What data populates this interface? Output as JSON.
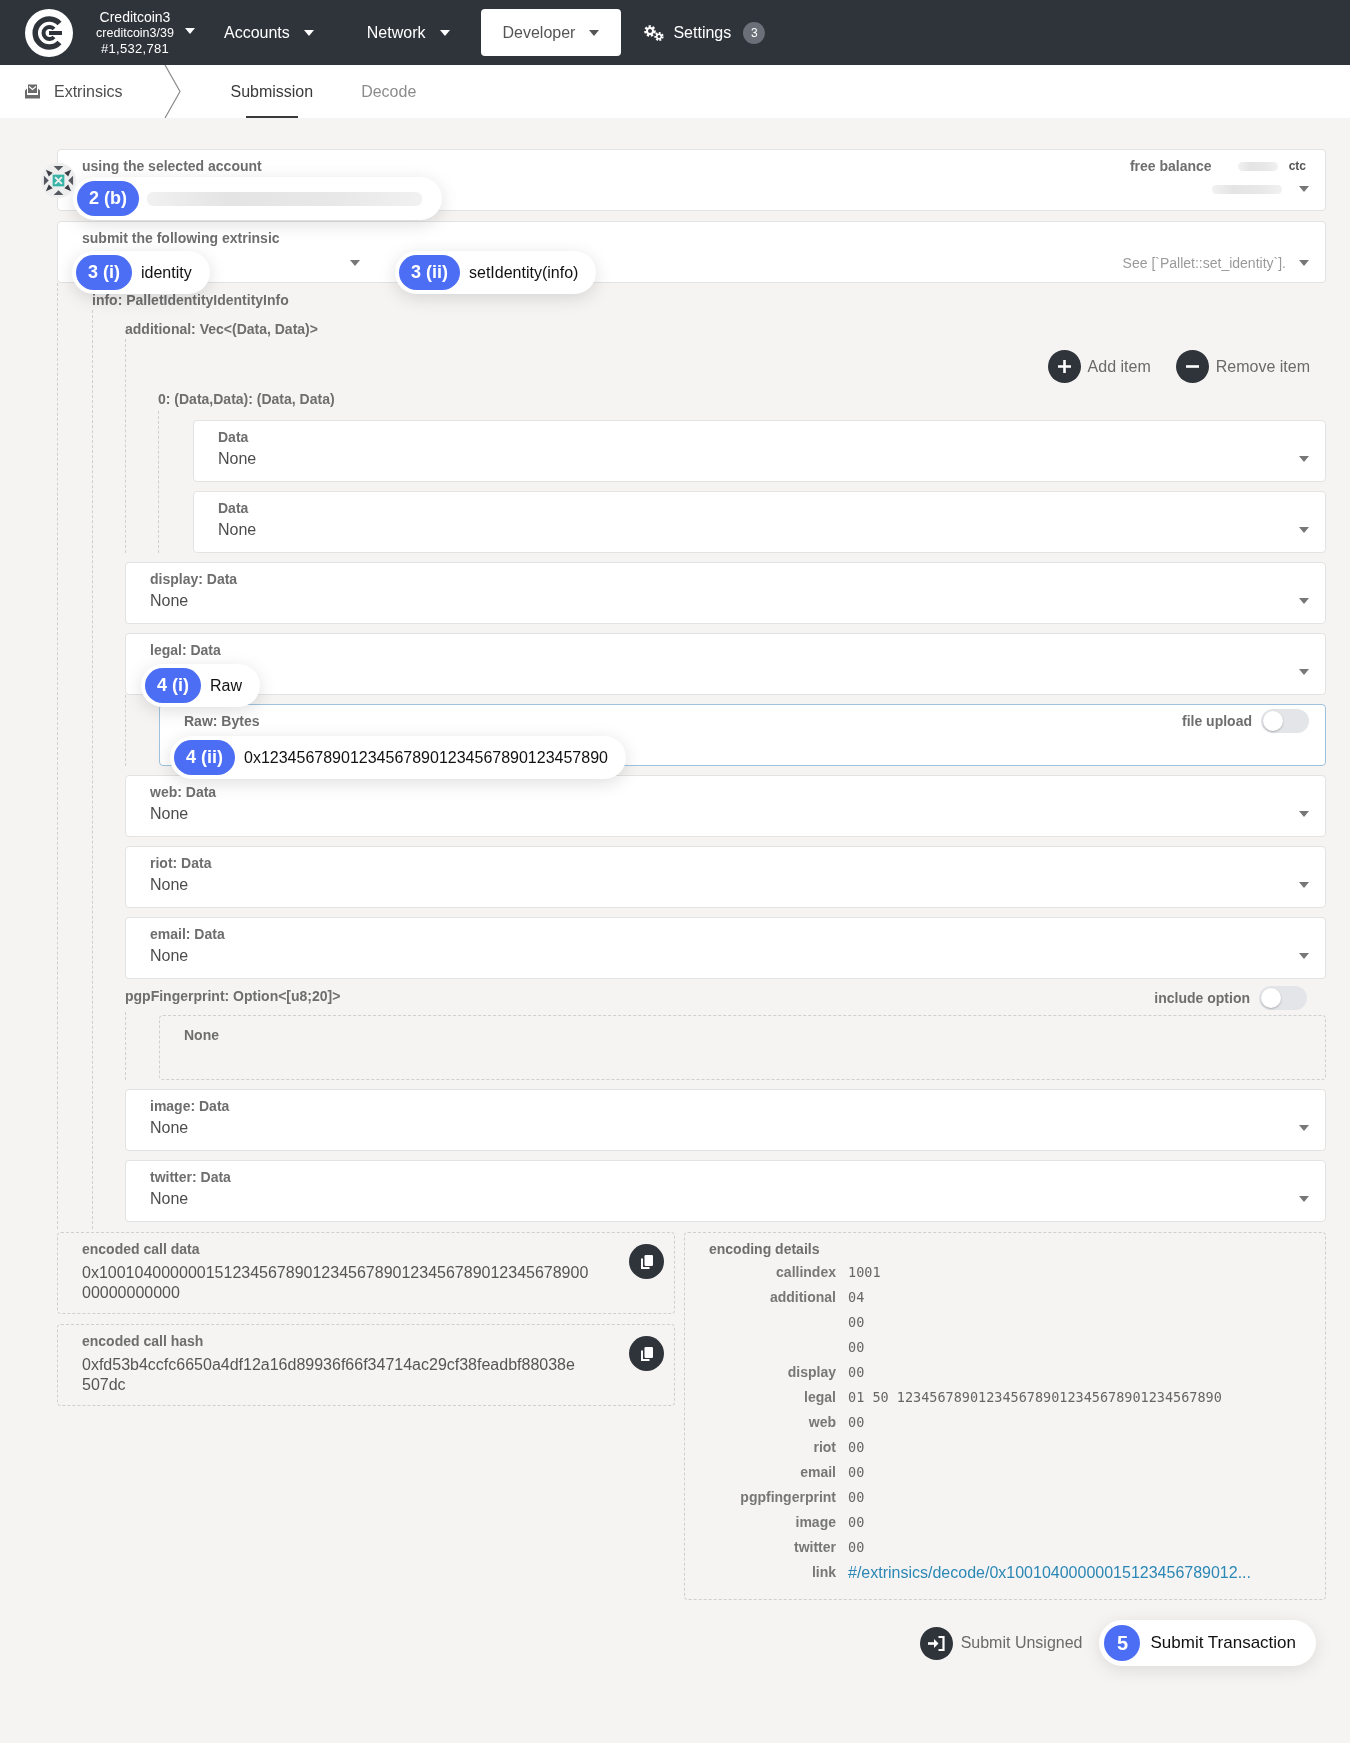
{
  "top_bar": {
    "chain": {
      "name": "Creditcoin3",
      "runtime": "creditcoin3/39",
      "block": "#1,532,781"
    },
    "menu": [
      {
        "kind": "dropdown",
        "label": "Accounts",
        "selected": false
      },
      {
        "kind": "dropdown",
        "label": "Network",
        "selected": false
      },
      {
        "kind": "dropdown",
        "label": "Developer",
        "selected": true
      },
      {
        "kind": "settings",
        "label": "Settings",
        "selected": false,
        "badge": "3"
      }
    ]
  },
  "sub_nav": {
    "section": "Extrinsics",
    "tabs": [
      {
        "label": "Submission",
        "selected": true
      },
      {
        "label": "Decode",
        "selected": false
      }
    ]
  },
  "account": {
    "label": "using the selected account",
    "step": "2 (b)",
    "balance_label": "free balance",
    "balance_unit": "ctc"
  },
  "extrinsic": {
    "label": "submit the following extrinsic",
    "section": {
      "step": "3 (i)",
      "value": "identity"
    },
    "method": {
      "step": "3 (ii)",
      "value": "setIdentity(info)"
    },
    "doc": "See [`Pallet::set_identity`]."
  },
  "params": {
    "label": "info: PalletIdentityIdentityInfo",
    "fields": [
      {
        "kind": "vec",
        "label": "additional: Vec<(Data, Data)>",
        "buttons": [
          {
            "kind": "add",
            "label": "Add item"
          },
          {
            "kind": "remove",
            "label": "Remove item"
          }
        ],
        "items": [
          {
            "label": "0: (Data,Data): (Data, Data)",
            "fields": [
              {
                "kind": "select",
                "label": "Data",
                "value": "None"
              },
              {
                "kind": "select",
                "label": "Data",
                "value": "None"
              }
            ]
          }
        ]
      },
      {
        "kind": "select",
        "label": "display: Data",
        "value": "None"
      },
      {
        "kind": "select",
        "label": "legal: Data",
        "step": "4 (i)",
        "value": "Raw",
        "sub": {
          "label": "Raw: Bytes",
          "toggle_label": "file upload",
          "on": false,
          "step": "4 (ii)",
          "value": "0x123456789012345678901234567890123457890"
        }
      },
      {
        "kind": "select",
        "label": "web: Data",
        "value": "None"
      },
      {
        "kind": "select",
        "label": "riot: Data",
        "value": "None"
      },
      {
        "kind": "select",
        "label": "email: Data",
        "value": "None"
      },
      {
        "kind": "option",
        "label": "pgpFingerprint: Option<[u8;20]>",
        "toggle_label": "include option",
        "on": false,
        "value": "None"
      },
      {
        "kind": "select",
        "label": "image: Data",
        "value": "None"
      },
      {
        "kind": "select",
        "label": "twitter: Data",
        "value": "None"
      }
    ]
  },
  "encoded": [
    {
      "label": "encoded call data",
      "lines": [
        "0x1001040000001512345678901234567890123456789012345678900",
        "00000000000"
      ]
    },
    {
      "label": "encoded call hash",
      "lines": [
        "0xfd53b4ccfc6650a4df12a16d89936f66f34714ac29cf38feadbf88038e",
        "507dc"
      ]
    }
  ],
  "encoding_details": {
    "title": "encoding details",
    "rows": [
      {
        "label": "callindex",
        "value": "1001"
      },
      {
        "label": "additional",
        "value": "04"
      },
      {
        "value": "00"
      },
      {
        "value": "00"
      },
      {
        "label": "display",
        "value": "00"
      },
      {
        "label": "legal",
        "value": "01 50 1234567890123456789012345678901234567890"
      },
      {
        "label": "web",
        "value": "00"
      },
      {
        "label": "riot",
        "value": "00"
      },
      {
        "label": "email",
        "value": "00"
      },
      {
        "label": "pgpfingerprint",
        "value": "00"
      },
      {
        "label": "image",
        "value": "00"
      },
      {
        "label": "twitter",
        "value": "00"
      },
      {
        "kind": "link",
        "label": "link",
        "value": "#/extrinsics/decode/0x10010400000015123456789012..."
      }
    ]
  },
  "actions": [
    {
      "kind": "plain",
      "label": "Submit Unsigned"
    },
    {
      "kind": "primary",
      "label": "Submit Transaction",
      "step": "5"
    }
  ]
}
